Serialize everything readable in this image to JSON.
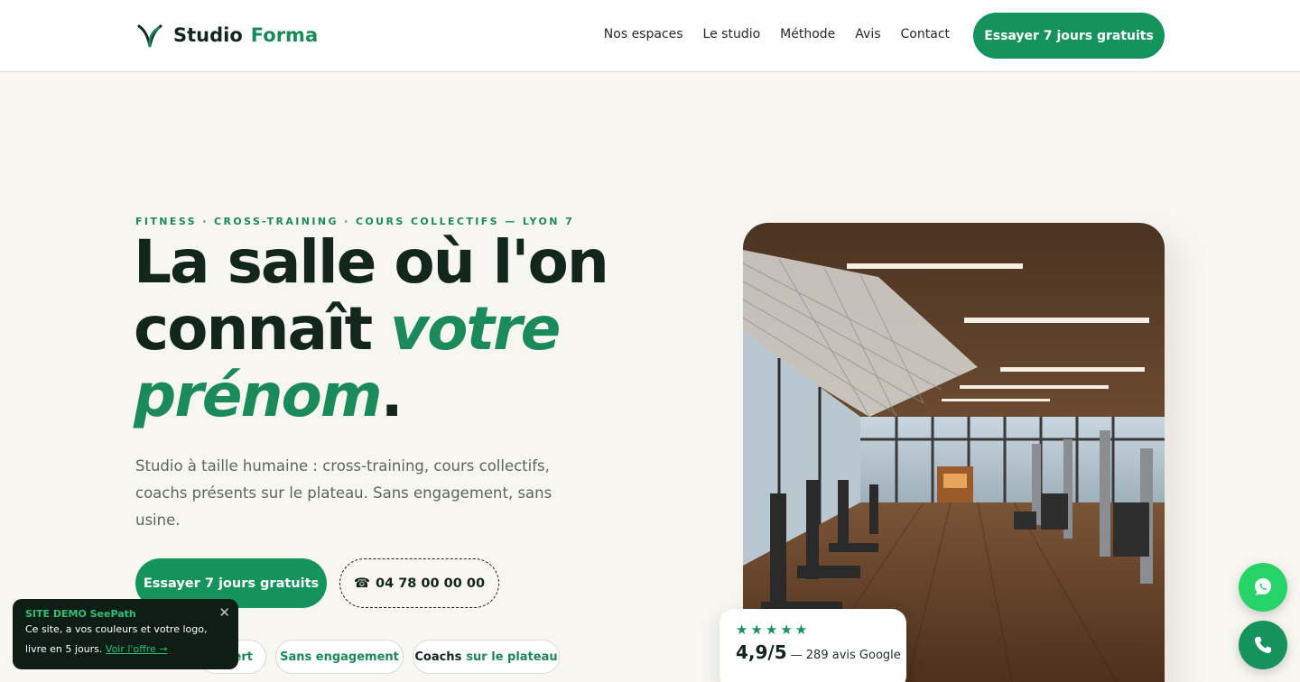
{
  "brand": {
    "name_part1": "Studio",
    "name_part2": "Forma",
    "icon": "leaf-logo-icon",
    "accent": "#14935c"
  },
  "nav": {
    "links": [
      "Nos espaces",
      "Le studio",
      "Méthode",
      "Avis",
      "Contact"
    ],
    "cta": "Essayer 7 jours gratuits"
  },
  "hero": {
    "eyebrow": "FITNESS · CROSS-TRAINING · COURS COLLECTIFS — LYON 7",
    "title_line1": "La salle où l'on",
    "title_line2_plain": "connaît ",
    "title_line2_green": "votre",
    "title_line3_green": "prénom",
    "title_period": ".",
    "lead": "Studio à taille humaine : cross-training, cours collectifs, coachs présents sur le plateau. Sans engagement, sans usine.",
    "cta_primary": "Essayer 7 jours gratuits",
    "phone_icon": "☎",
    "phone": "04 78 00 00 00"
  },
  "pills": [
    {
      "strong": "",
      "text": "ert"
    },
    {
      "strong": "",
      "text": "Sans engagement"
    },
    {
      "strong": "Coachs",
      "text": "sur le plateau"
    }
  ],
  "rating": {
    "stars": "★★★★★",
    "score": "4,9/5",
    "detail": "— 289 avis Google"
  },
  "toast": {
    "title": "SITE DEMO SeePath",
    "text": "Ce site, a vos couleurs et votre logo, livre en 5 jours.",
    "link": "Voir l'offre →",
    "close": "✕"
  },
  "fabs": {
    "whatsapp_icon": "whatsapp-icon",
    "phone_icon": "phone-icon"
  }
}
